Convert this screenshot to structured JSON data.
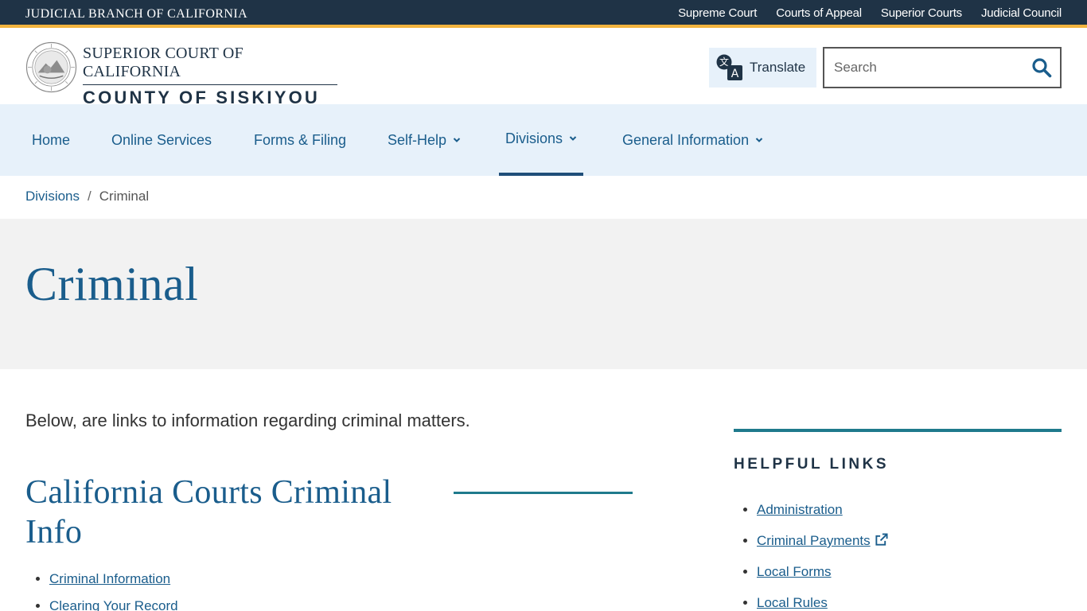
{
  "utility_bar": {
    "brand": "JUDICIAL BRANCH OF CALIFORNIA",
    "links": [
      "Supreme Court",
      "Courts of Appeal",
      "Superior Courts",
      "Judicial Council"
    ]
  },
  "header": {
    "court_line1": "SUPERIOR COURT OF CALIFORNIA",
    "court_line2": "COUNTY OF SISKIYOU",
    "translate_label": "Translate",
    "search_placeholder": "Search"
  },
  "nav": {
    "items": [
      {
        "label": "Home"
      },
      {
        "label": "Online Services"
      },
      {
        "label": "Forms & Filing"
      },
      {
        "label": "Self-Help"
      },
      {
        "label": "Divisions"
      },
      {
        "label": "General Information"
      }
    ],
    "active": "Divisions"
  },
  "breadcrumb": {
    "parent": "Divisions",
    "separator": "/",
    "current": "Criminal"
  },
  "page": {
    "title": "Criminal",
    "intro": "Below, are links to information regarding criminal matters.",
    "section_heading": "California Courts Criminal Info",
    "section_links": [
      "Criminal Information",
      "Clearing Your Record"
    ]
  },
  "sidebar": {
    "heading": "HELPFUL LINKS",
    "links": [
      {
        "label": "Administration",
        "external": false
      },
      {
        "label": "Criminal Payments",
        "external": true
      },
      {
        "label": "Local Forms",
        "external": false
      },
      {
        "label": "Local Rules",
        "external": false
      }
    ]
  },
  "colors": {
    "utility_bg": "#1f3346",
    "accent_gold": "#f2b33d",
    "link_blue": "#1a5d8c",
    "nav_bg": "#e7f1fa",
    "teal_rule": "#1f7a8c",
    "title_band_bg": "#f2f2f2"
  },
  "icons": {
    "seal": "court-seal-icon",
    "translate": "translate-icon",
    "search": "search-icon",
    "chevron": "chevron-down-icon",
    "external": "external-link-icon"
  }
}
